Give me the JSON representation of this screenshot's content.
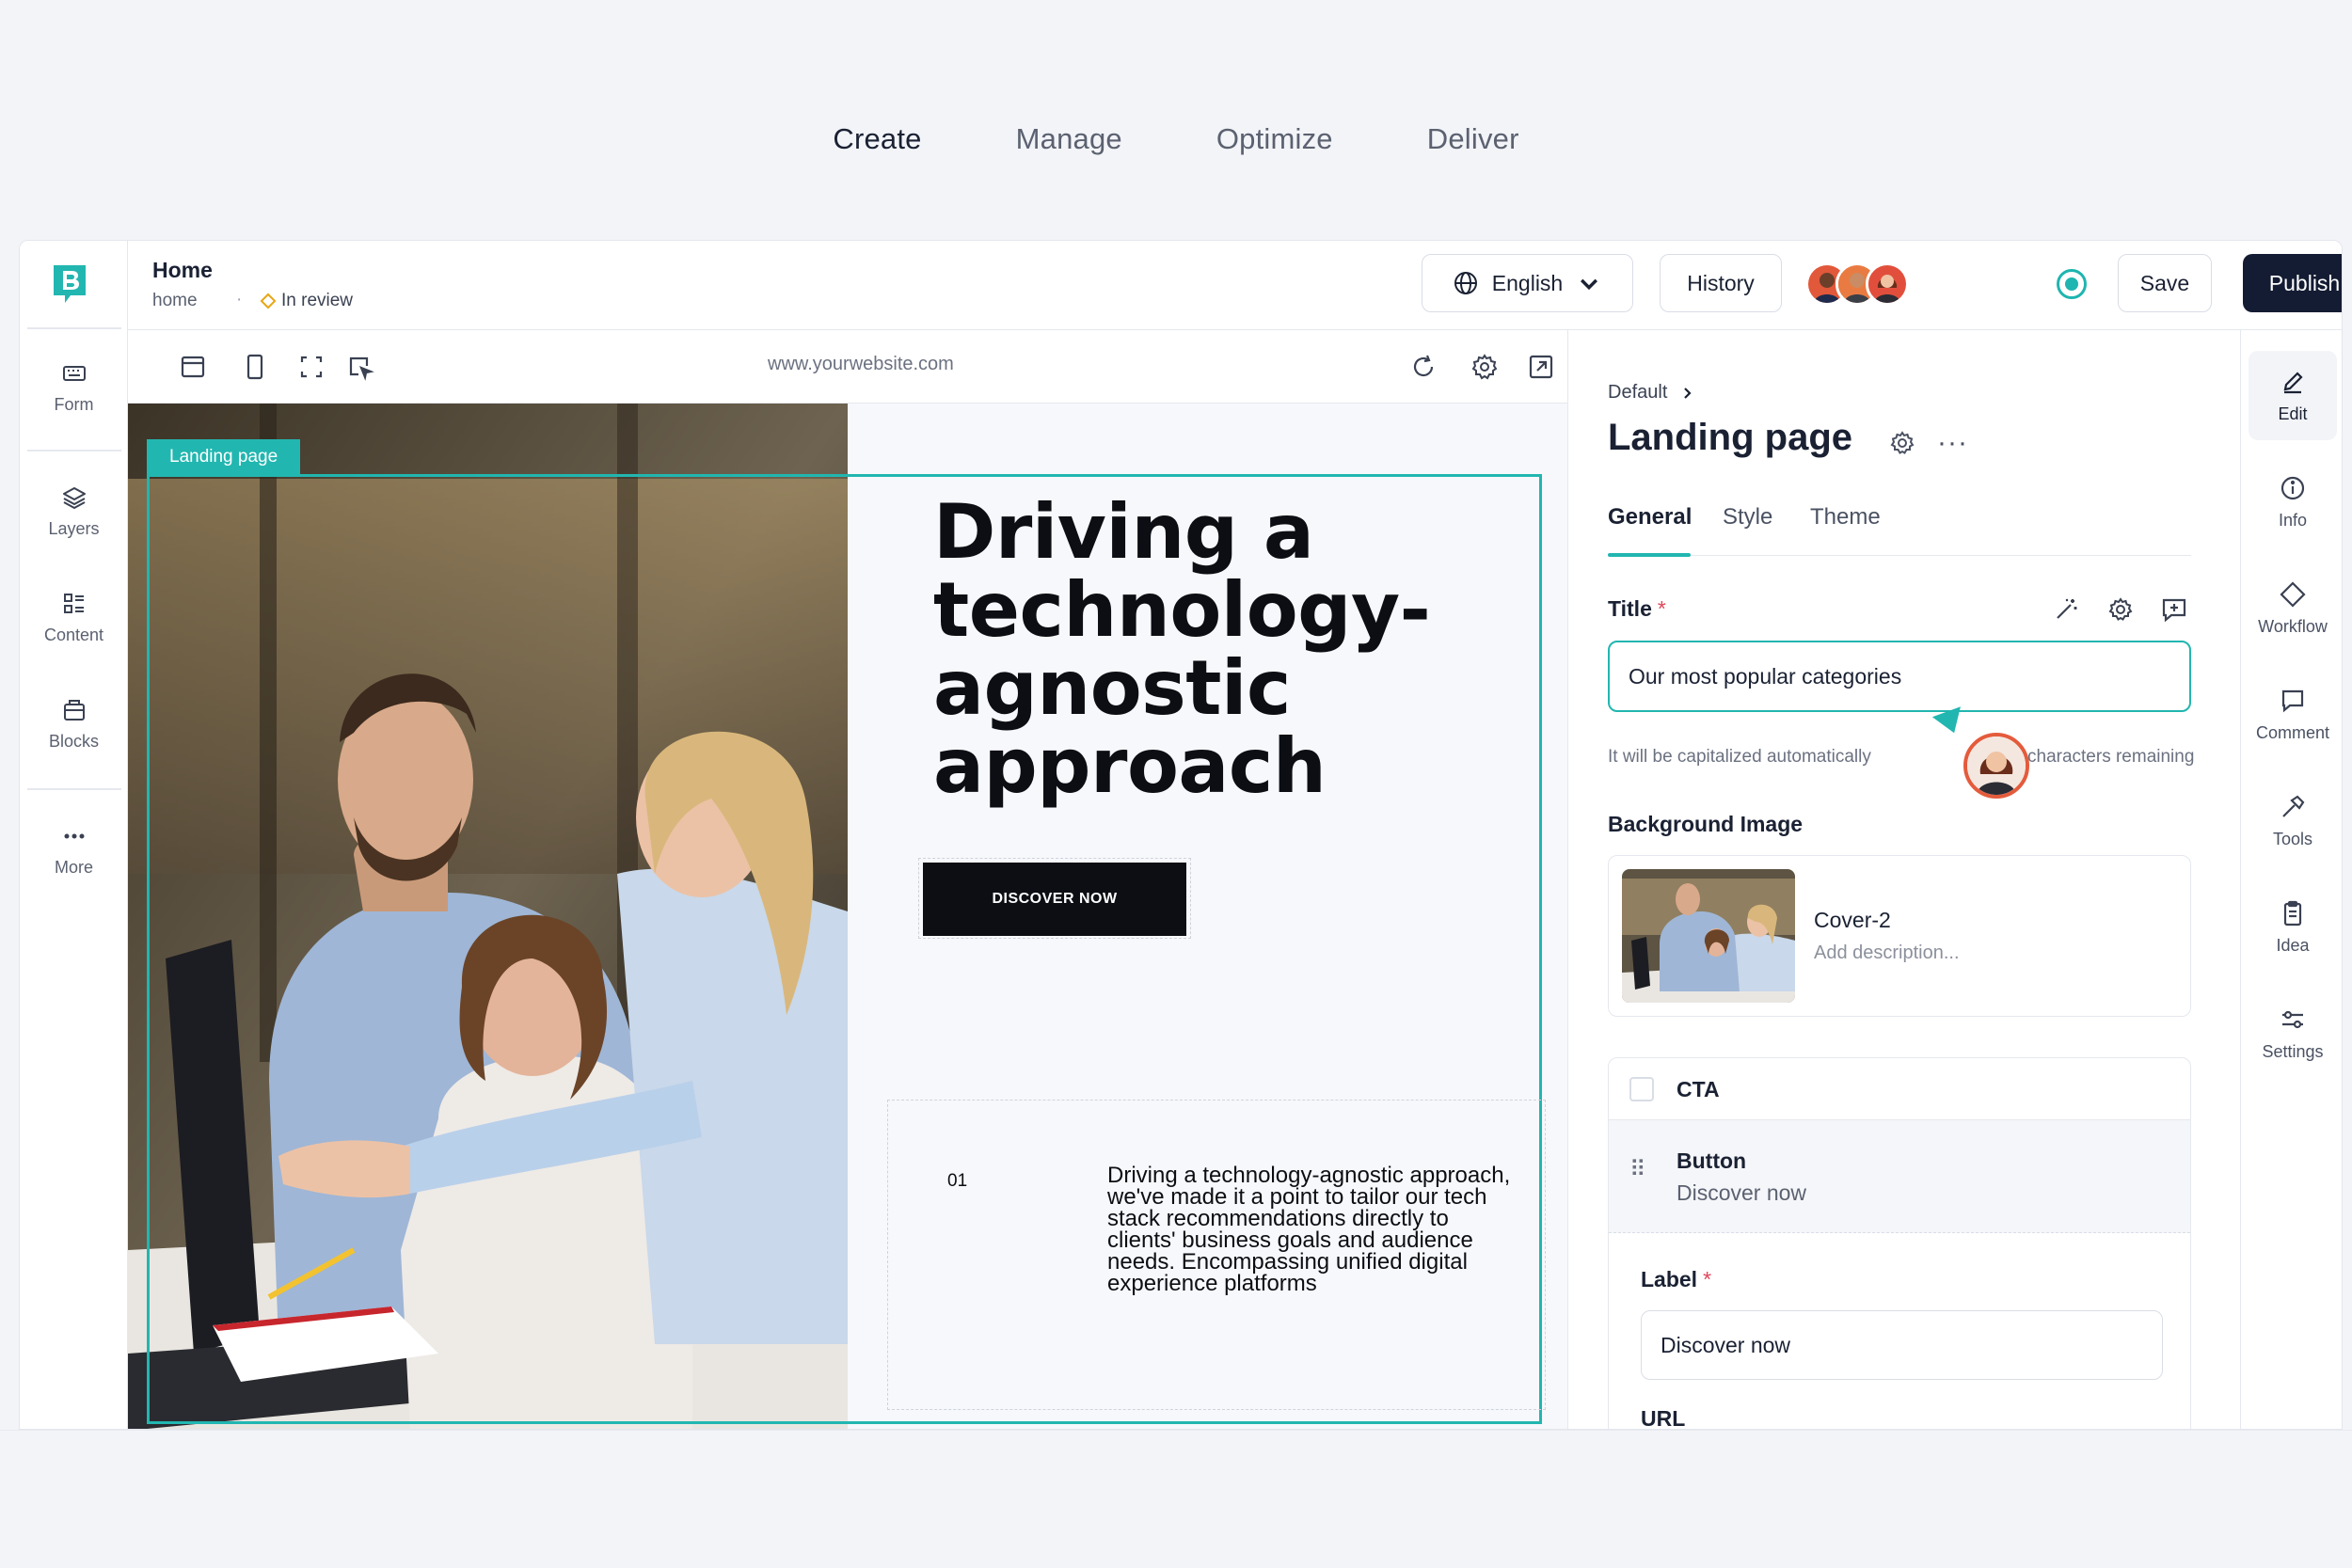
{
  "top_nav": {
    "items": [
      {
        "label": "Create",
        "active": true
      },
      {
        "label": "Manage",
        "active": false
      },
      {
        "label": "Optimize",
        "active": false
      },
      {
        "label": "Deliver",
        "active": false
      }
    ]
  },
  "left_rail": {
    "logo": "B",
    "items": [
      {
        "label": "Form",
        "icon": "keyboard-icon"
      },
      {
        "label": "Layers",
        "icon": "layers-icon"
      },
      {
        "label": "Content",
        "icon": "content-icon"
      },
      {
        "label": "Blocks",
        "icon": "blocks-icon"
      },
      {
        "label": "More",
        "icon": "more-icon"
      }
    ]
  },
  "header": {
    "page_name": "Home",
    "page_slug": "home",
    "separator": "·",
    "status": "In review",
    "language": "English",
    "history_label": "History",
    "save_label": "Save",
    "publish_label": "Publish"
  },
  "toolbar": {
    "url": "www.yourwebsite.com"
  },
  "canvas": {
    "selection_tag": "Landing page",
    "hero_title": "Driving a technology-agnostic approach",
    "cta_label": "DISCOVER NOW",
    "feature_number": "01",
    "feature_text": "Driving a technology-agnostic approach, we've made it a point to tailor our tech stack recommendations directly to clients' business goals and audience needs. Encompassing unified digital experience platforms"
  },
  "panel": {
    "breadcrumb": "Default",
    "title": "Landing page",
    "tabs": [
      {
        "label": "General",
        "active": true
      },
      {
        "label": "Style",
        "active": false
      },
      {
        "label": "Theme",
        "active": false
      }
    ],
    "title_field": {
      "label": "Title",
      "required_mark": "*",
      "value": "Our most popular categories",
      "hint": "It will be capitalized automatically",
      "remaining": "characters remaining"
    },
    "background_image": {
      "label": "Background Image",
      "name": "Cover-2",
      "description_placeholder": "Add description..."
    },
    "cta": {
      "title": "CTA",
      "button_title": "Button",
      "button_sub": "Discover now",
      "label_field": {
        "label": "Label",
        "required_mark": "*",
        "value": "Discover now"
      },
      "url_label": "URL"
    }
  },
  "right_rail": {
    "items": [
      {
        "label": "Edit",
        "icon": "pencil-icon",
        "active": true
      },
      {
        "label": "Info",
        "icon": "info-icon",
        "active": false
      },
      {
        "label": "Workflow",
        "icon": "workflow-icon",
        "active": false
      },
      {
        "label": "Comment",
        "icon": "comment-icon",
        "active": false
      },
      {
        "label": "Tools",
        "icon": "hammer-icon",
        "active": false
      },
      {
        "label": "Idea",
        "icon": "clipboard-icon",
        "active": false
      },
      {
        "label": "Settings",
        "icon": "sliders-icon",
        "active": false
      }
    ]
  },
  "colors": {
    "accent": "#22b6b0",
    "primary_dark": "#141c33",
    "status_warning": "#e8a614"
  }
}
